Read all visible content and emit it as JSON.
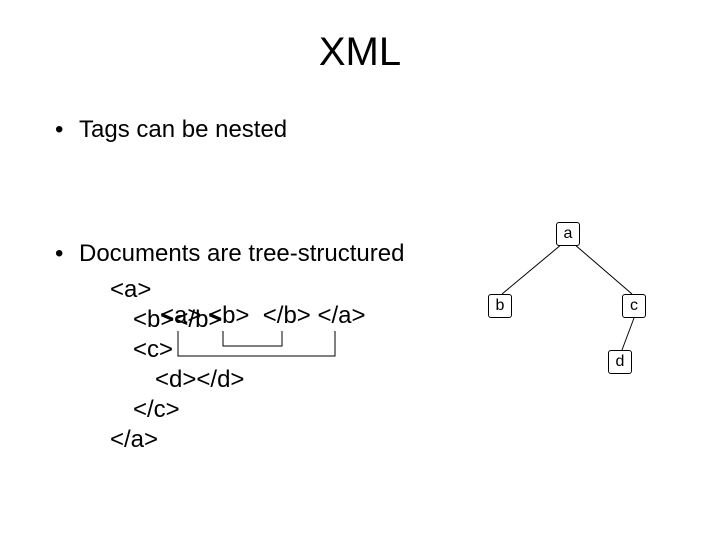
{
  "title": "XML",
  "bullet1": {
    "text": "Tags can be nested",
    "code": "<a> <b>  </b> </a>"
  },
  "bullet2": {
    "text": "Documents are tree-structured",
    "code": {
      "l1": "<a>",
      "l2": "<b></b>",
      "l3": "<c>",
      "l4": "<d></d>",
      "l5": "</c>",
      "l6": "</a>"
    }
  },
  "tree": {
    "a": "a",
    "b": "b",
    "c": "c",
    "d": "d"
  },
  "dot": "•"
}
